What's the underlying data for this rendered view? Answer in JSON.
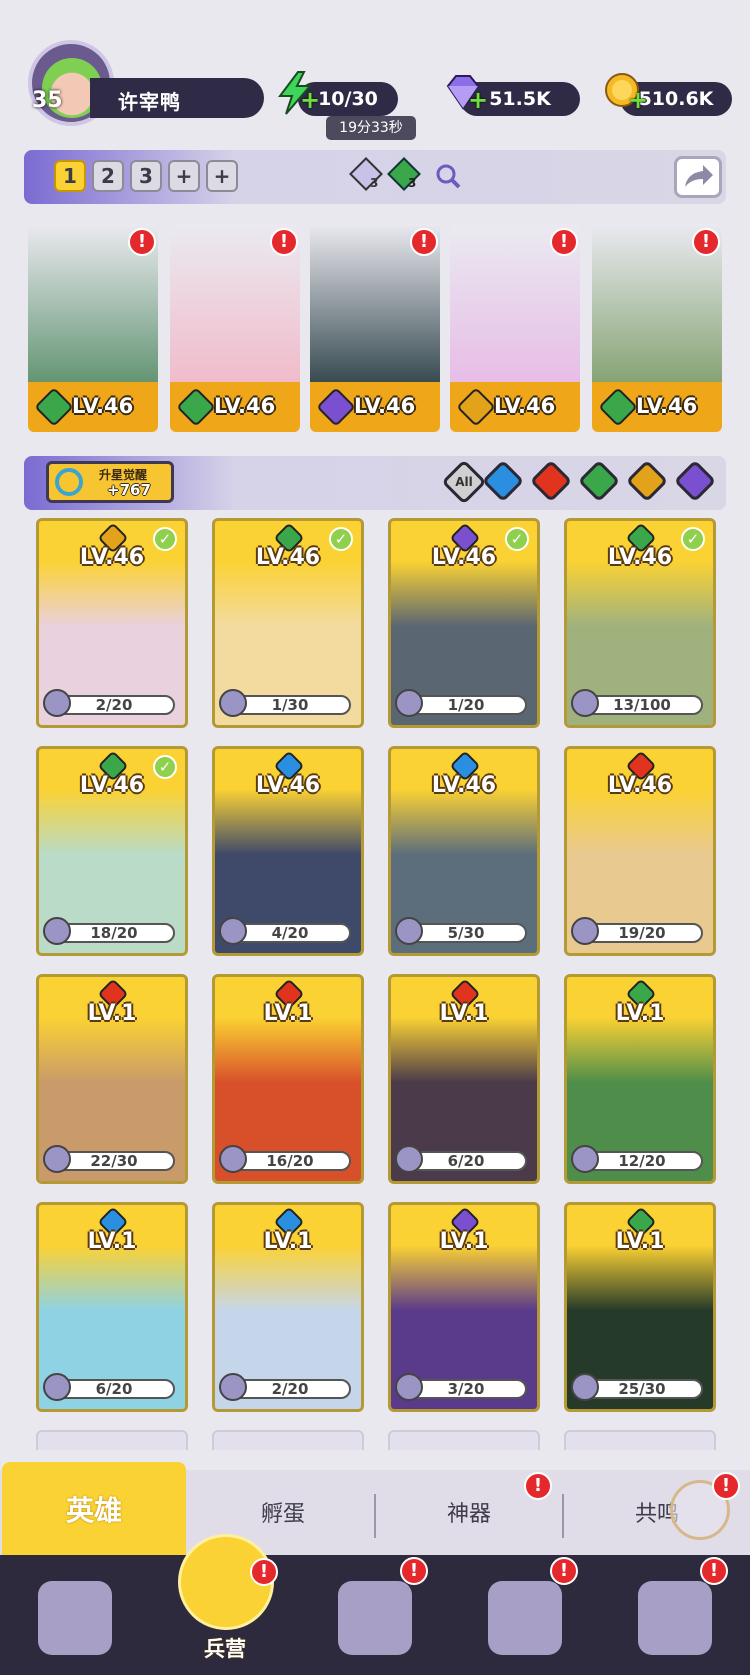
{
  "player": {
    "level": "35",
    "name": "许宰鸭"
  },
  "resources": {
    "energy": {
      "value": "10/30",
      "timer": "19分33秒",
      "icon": "lightning-icon",
      "color": "#3fd45a"
    },
    "gems": {
      "value": "51.5K",
      "icon": "diamond-icon",
      "color": "#8b6ee8"
    },
    "coins": {
      "value": "510.6K",
      "icon": "coin-icon",
      "color": "#f5b925"
    }
  },
  "team_slots": [
    "1",
    "2",
    "3",
    "+",
    "+"
  ],
  "team_counters": [
    {
      "value": "3",
      "icon": "crystal-icon"
    },
    {
      "value": "3",
      "icon": "wind-icon"
    }
  ],
  "team_heroes": [
    {
      "level": "LV.46",
      "element": "nature",
      "color": "#3aa84a",
      "art": "#5a8f6a"
    },
    {
      "level": "LV.46",
      "element": "nature",
      "color": "#3aa84a",
      "art": "#f1b8c8"
    },
    {
      "level": "LV.46",
      "element": "dark",
      "color": "#7a4fd0",
      "art": "#2a3f45"
    },
    {
      "level": "LV.46",
      "element": "light",
      "color": "#e2a21a",
      "art": "#e7b9e6"
    },
    {
      "level": "LV.46",
      "element": "nature",
      "color": "#3aa84a",
      "art": "#7f9e6c"
    }
  ],
  "awakening": {
    "label": "升星觉醒",
    "value": "+767"
  },
  "filters": {
    "all_label": "All",
    "elements": [
      {
        "name": "water",
        "color": "#2a8fe0"
      },
      {
        "name": "fire",
        "color": "#e0341e"
      },
      {
        "name": "nature",
        "color": "#3aa84a"
      },
      {
        "name": "light",
        "color": "#e2a21a"
      },
      {
        "name": "dark",
        "color": "#7a4fd0"
      }
    ]
  },
  "heroes": [
    {
      "level": "LV.46",
      "progress": "2/20",
      "element_color": "#e2a21a",
      "checked": true,
      "art": "#e9d1de"
    },
    {
      "level": "LV.46",
      "progress": "1/30",
      "element_color": "#3aa84a",
      "checked": true,
      "art": "#f3dba0"
    },
    {
      "level": "LV.46",
      "progress": "1/20",
      "element_color": "#7a4fd0",
      "checked": true,
      "art": "#5a6672"
    },
    {
      "level": "LV.46",
      "progress": "13/100",
      "element_color": "#3aa84a",
      "checked": true,
      "art": "#9fb27e"
    },
    {
      "level": "LV.46",
      "progress": "18/20",
      "element_color": "#3aa84a",
      "checked": true,
      "art": "#b9dbc8"
    },
    {
      "level": "LV.46",
      "progress": "4/20",
      "element_color": "#2a8fe0",
      "checked": false,
      "art": "#3f4a6a"
    },
    {
      "level": "LV.46",
      "progress": "5/30",
      "element_color": "#2a8fe0",
      "checked": false,
      "art": "#5c6e7c"
    },
    {
      "level": "LV.46",
      "progress": "19/20",
      "element_color": "#e0341e",
      "checked": false,
      "art": "#e8c990"
    },
    {
      "level": "LV.1",
      "progress": "22/30",
      "element_color": "#e0341e",
      "checked": false,
      "art": "#c99a6a"
    },
    {
      "level": "LV.1",
      "progress": "16/20",
      "element_color": "#e0341e",
      "checked": false,
      "art": "#d8502a"
    },
    {
      "level": "LV.1",
      "progress": "6/20",
      "element_color": "#e0341e",
      "checked": false,
      "art": "#4a3a4a"
    },
    {
      "level": "LV.1",
      "progress": "12/20",
      "element_color": "#3aa84a",
      "checked": false,
      "art": "#4f8e4a"
    },
    {
      "level": "LV.1",
      "progress": "6/20",
      "element_color": "#2a8fe0",
      "checked": false,
      "art": "#8fd2e4"
    },
    {
      "level": "LV.1",
      "progress": "2/20",
      "element_color": "#2a8fe0",
      "checked": false,
      "art": "#c6d6ea"
    },
    {
      "level": "LV.1",
      "progress": "3/20",
      "element_color": "#7a4fd0",
      "checked": false,
      "art": "#5a3a8a"
    },
    {
      "level": "LV.1",
      "progress": "25/30",
      "element_color": "#3aa84a",
      "checked": false,
      "art": "#263a2a"
    }
  ],
  "subtabs": [
    {
      "label": "英雄",
      "active": true
    },
    {
      "label": "孵蛋",
      "active": false
    },
    {
      "label": "神器",
      "active": false,
      "alert": true
    },
    {
      "label": "共鸣",
      "active": false,
      "alert": true
    }
  ],
  "nav": [
    {
      "icon": "cards-icon",
      "label": ""
    },
    {
      "icon": "barracks-icon",
      "label": "兵营",
      "active": true,
      "alert": true
    },
    {
      "icon": "map-icon",
      "label": "",
      "alert": true
    },
    {
      "icon": "shop-icon",
      "label": "",
      "alert": true
    },
    {
      "icon": "mushroom-house-icon",
      "label": "",
      "alert": true
    }
  ]
}
